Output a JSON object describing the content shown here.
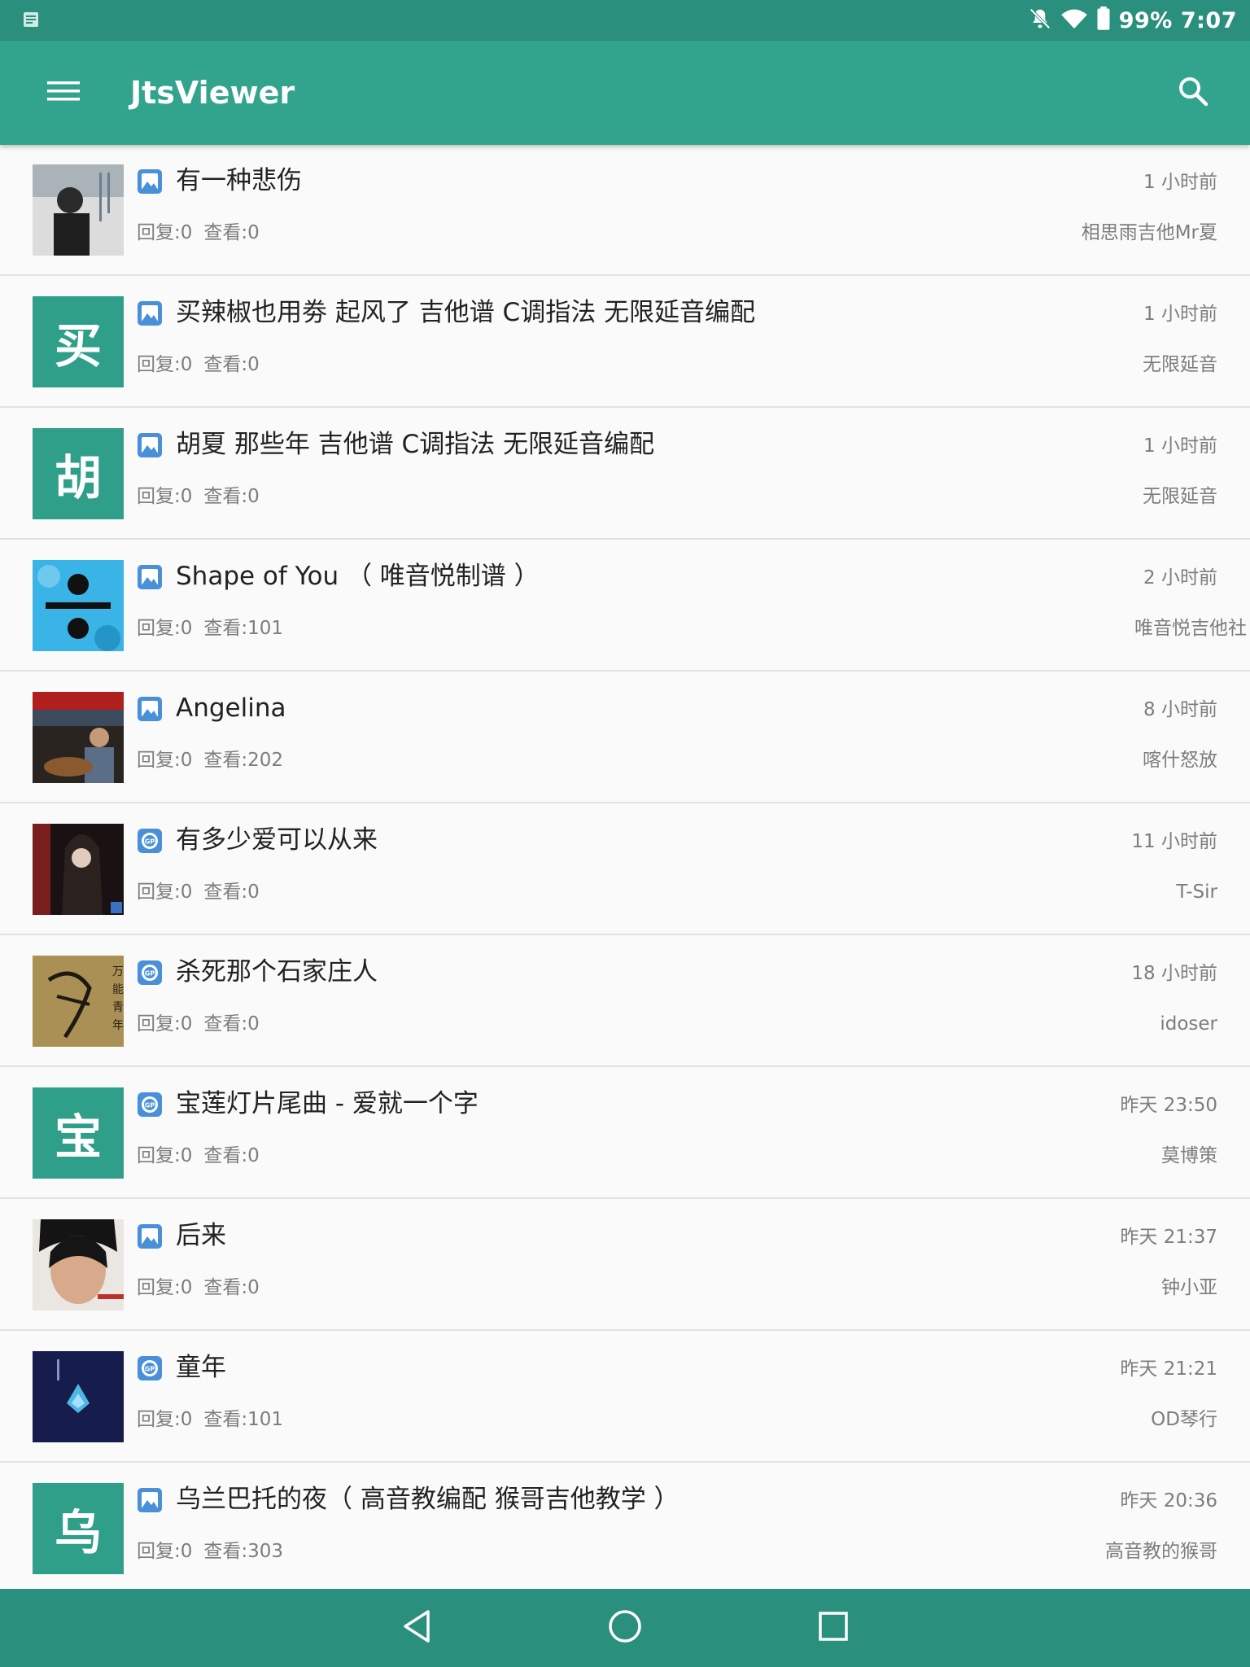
{
  "status_bar": {
    "battery": "99%",
    "time": "7:07"
  },
  "app_bar": {
    "title": "JtsViewer"
  },
  "posts": [
    {
      "title": "有一种悲伤",
      "replies": "回复:0",
      "views": "查看:0",
      "time": "1 小时前",
      "author": "相思雨吉他Mr夏",
      "thumb": "photo",
      "icon": "image-icon"
    },
    {
      "title": "买辣椒也用劵 起风了 吉他谱 C调指法 无限延音编配",
      "replies": "回复:0",
      "views": "查看:0",
      "time": "1 小时前",
      "author": "无限延音",
      "thumb": "买",
      "icon": "image-icon"
    },
    {
      "title": "胡夏 那些年 吉他谱 C调指法 无限延音编配",
      "replies": "回复:0",
      "views": "查看:0",
      "time": "1 小时前",
      "author": "无限延音",
      "thumb": "胡",
      "icon": "image-icon"
    },
    {
      "title": "Shape of You （ 唯音悦制谱 ）",
      "replies": "回复:0",
      "views": "查看:101",
      "time": "2 小时前",
      "author": "唯音悦吉他社",
      "thumb": "photo",
      "icon": "image-icon"
    },
    {
      "title": "Angelina",
      "replies": "回复:0",
      "views": "查看:202",
      "time": "8 小时前",
      "author": "喀什怒放",
      "thumb": "photo",
      "icon": "image-icon"
    },
    {
      "title": "有多少爱可以从来",
      "replies": "回复:0",
      "views": "查看:0",
      "time": "11 小时前",
      "author": "T-Sir",
      "thumb": "photo",
      "icon": "gp-icon"
    },
    {
      "title": "杀死那个石家庄人",
      "replies": "回复:0",
      "views": "查看:0",
      "time": "18 小时前",
      "author": "idoser",
      "thumb": "photo",
      "icon": "gp-icon"
    },
    {
      "title": "宝莲灯片尾曲 - 爱就一个字",
      "replies": "回复:0",
      "views": "查看:0",
      "time": "昨天 23:50",
      "author": "莫博策",
      "thumb": "宝",
      "icon": "gp-icon"
    },
    {
      "title": "后来",
      "replies": "回复:0",
      "views": "查看:0",
      "time": "昨天 21:37",
      "author": "钟小亚",
      "thumb": "photo",
      "icon": "image-icon"
    },
    {
      "title": "童年",
      "replies": "回复:0",
      "views": "查看:101",
      "time": "昨天 21:21",
      "author": "OD琴行",
      "thumb": "photo",
      "icon": "gp-icon"
    },
    {
      "title": "乌兰巴托的夜（ 高音教编配 猴哥吉他教学 ）",
      "replies": "回复:0",
      "views": "查看:303",
      "time": "昨天 20:36",
      "author": "高音教的猴哥",
      "thumb": "乌",
      "icon": "image-icon"
    }
  ],
  "colors": {
    "primary": "#32a48e",
    "primary_dark": "#2a8f7c",
    "letter_tile": "#2f9f89",
    "icon_blue": "#4a90d9",
    "secondary_text": "#7d7d7d"
  }
}
